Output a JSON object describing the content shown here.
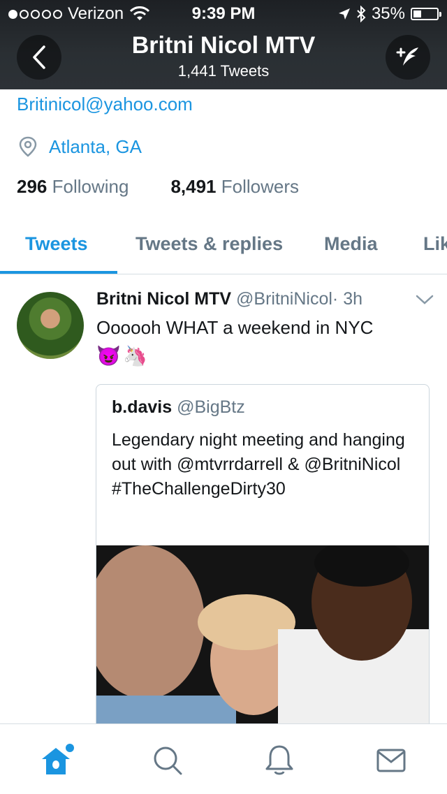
{
  "status_bar": {
    "carrier": "Verizon",
    "time": "9:39 PM",
    "battery": "35%",
    "battery_level": 0.35
  },
  "header": {
    "title": "Britni Nicol MTV",
    "subtitle": "1,441 Tweets",
    "back_icon": "chevron-left-icon",
    "compose_icon": "compose-tweet-icon"
  },
  "profile": {
    "email": "Britinicol@yahoo.com",
    "location": "Atlanta, GA",
    "following_count": "296",
    "following_label": "Following",
    "followers_count": "8,491",
    "followers_label": "Followers"
  },
  "tabs": [
    {
      "label": "Tweets",
      "active": true
    },
    {
      "label": "Tweets & replies",
      "active": false
    },
    {
      "label": "Media",
      "active": false
    },
    {
      "label": "Lik",
      "active": false
    }
  ],
  "tweet": {
    "name": "Britni Nicol MTV",
    "handle": "@BritniNicol",
    "time": "· 3h",
    "text": "Oooooh WHAT a weekend in NYC",
    "emojis": [
      "😈",
      "🦄"
    ],
    "quote": {
      "name": "b.davis",
      "handle": "@BigBtz",
      "text": "Legendary night meeting and hanging out with @mtvrrdarrell & @BritniNicol #TheChallengeDirty30"
    }
  },
  "bottom_nav": {
    "items": [
      "home-icon",
      "search-icon",
      "notifications-bell-icon",
      "messages-envelope-icon"
    ]
  },
  "colors": {
    "accent": "#1b95e0",
    "secondary_text": "#657786",
    "header_bg": "#2a2f33"
  }
}
